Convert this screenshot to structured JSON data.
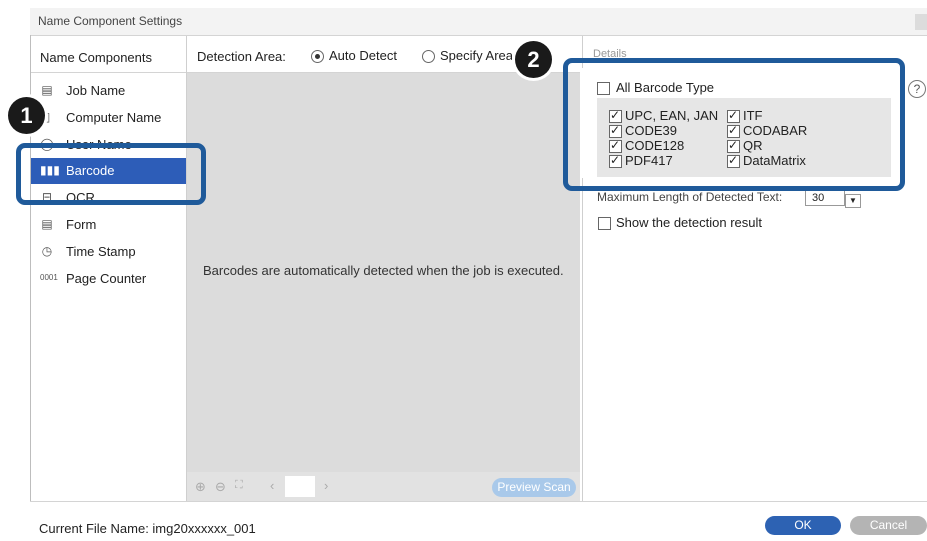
{
  "window": {
    "title": "Name Component Settings"
  },
  "sidebar": {
    "header": "Name Components",
    "items": [
      {
        "label": "Job Name",
        "icon": "document-icon"
      },
      {
        "label": "Computer Name",
        "icon": "computer-icon"
      },
      {
        "label": "User Name",
        "icon": "user-icon"
      },
      {
        "label": "Barcode",
        "icon": "barcode-icon",
        "selected": true
      },
      {
        "label": "OCR",
        "icon": "ocr-icon"
      },
      {
        "label": "Form",
        "icon": "form-icon"
      },
      {
        "label": "Time Stamp",
        "icon": "clock-icon"
      },
      {
        "label": "Page Counter",
        "icon": "counter-icon"
      }
    ]
  },
  "detection": {
    "label": "Detection Area:",
    "auto_label": "Auto Detect",
    "specify_label": "Specify Area",
    "selected": "auto"
  },
  "preview": {
    "message": "Barcodes are automatically detected when the job is executed.",
    "scan_button": "Preview Scan"
  },
  "details": {
    "header": "Details",
    "all_barcode_label": "All Barcode Type",
    "all_barcode_checked": false,
    "types": [
      {
        "label": "UPC, EAN, JAN",
        "checked": true
      },
      {
        "label": "ITF",
        "checked": true
      },
      {
        "label": "CODE39",
        "checked": true
      },
      {
        "label": "CODABAR",
        "checked": true
      },
      {
        "label": "CODE128",
        "checked": true
      },
      {
        "label": "QR",
        "checked": true
      },
      {
        "label": "PDF417",
        "checked": true
      },
      {
        "label": "DataMatrix",
        "checked": true
      }
    ],
    "max_length_label": "Maximum Length of Detected Text:",
    "max_length_value": "30",
    "show_result_label": "Show the detection result",
    "show_result_checked": false
  },
  "footer": {
    "file_name_label": "Current File Name: img20xxxxxx_001",
    "ok_label": "OK",
    "cancel_label": "Cancel"
  },
  "callouts": {
    "one": "1",
    "two": "2"
  },
  "colors": {
    "selection": "#2d5db8",
    "callout": "#1f5a9a",
    "ok_button": "#2d62b3"
  }
}
